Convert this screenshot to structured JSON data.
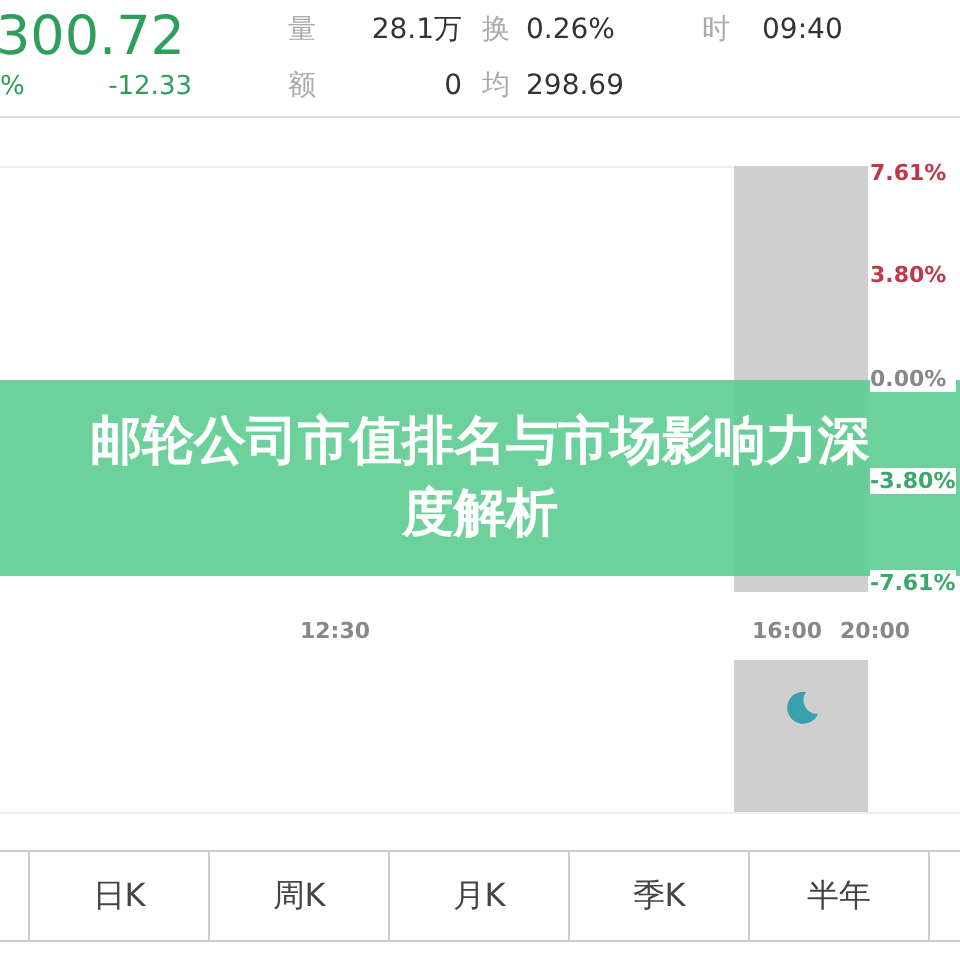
{
  "quote": {
    "price": "300.72",
    "change_pct": "%",
    "change": "-12.33"
  },
  "stats": [
    {
      "label": "量",
      "value": "28.1万"
    },
    {
      "label": "额",
      "value": "0"
    },
    {
      "label": "换",
      "value": "0.26%"
    },
    {
      "label": "均",
      "value": "298.69"
    },
    {
      "label": "时",
      "value": "09:40"
    }
  ],
  "axis_labels": [
    {
      "text": "7.61%",
      "color": "#c0394b"
    },
    {
      "text": "3.80%",
      "color": "#c0394b"
    },
    {
      "text": "0.00%",
      "color": "#888888"
    },
    {
      "text": "-3.80%",
      "color": "#3aa86a"
    },
    {
      "text": "-7.61%",
      "color": "#3aa86a"
    }
  ],
  "time_labels": [
    "12:30",
    "16:00",
    "20:00"
  ],
  "tabs": [
    {
      "label": "日K"
    },
    {
      "label": "周K"
    },
    {
      "label": "月K"
    },
    {
      "label": "季K"
    },
    {
      "label": "半年"
    }
  ],
  "banner": {
    "title": "邮轮公司市值排名与市场影响力深度解析"
  }
}
